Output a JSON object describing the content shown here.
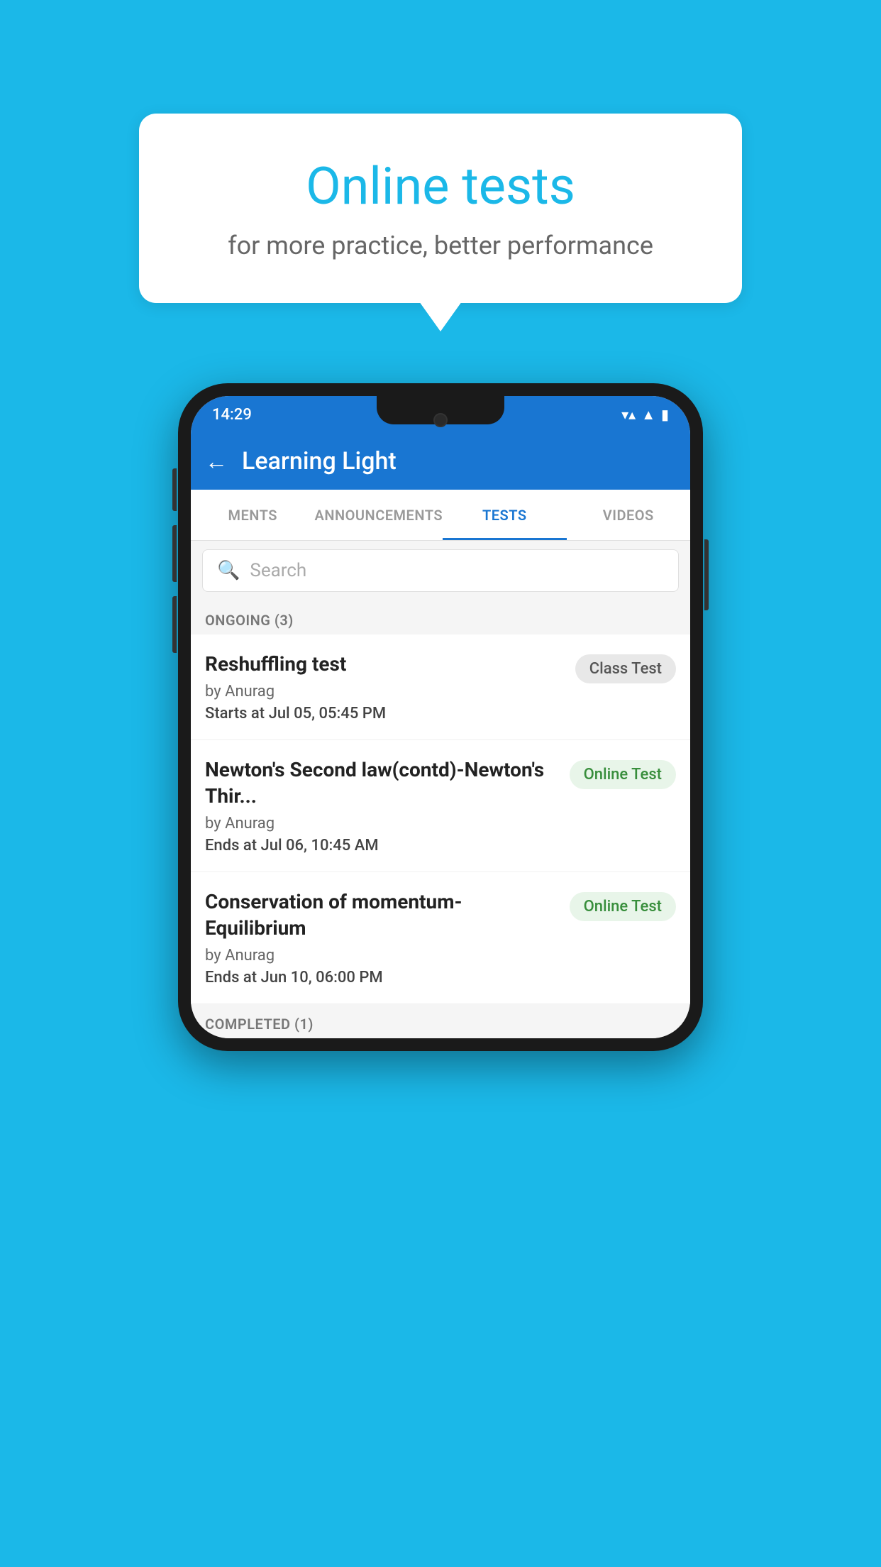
{
  "background_color": "#1BB8E8",
  "bubble": {
    "title": "Online tests",
    "subtitle": "for more practice, better performance"
  },
  "phone": {
    "status_bar": {
      "time": "14:29",
      "wifi": "▼",
      "signal": "▲",
      "battery": "▮"
    },
    "app_bar": {
      "back_label": "←",
      "title": "Learning Light"
    },
    "tabs": [
      {
        "label": "MENTS",
        "active": false
      },
      {
        "label": "ANNOUNCEMENTS",
        "active": false
      },
      {
        "label": "TESTS",
        "active": true
      },
      {
        "label": "VIDEOS",
        "active": false
      }
    ],
    "search": {
      "placeholder": "Search"
    },
    "ongoing_section": {
      "label": "ONGOING (3)"
    },
    "tests": [
      {
        "name": "Reshuffling test",
        "author": "by Anurag",
        "time_label": "Starts at",
        "time_value": "Jul 05, 05:45 PM",
        "badge": "Class Test",
        "badge_type": "class"
      },
      {
        "name": "Newton's Second law(contd)-Newton's Thir...",
        "author": "by Anurag",
        "time_label": "Ends at",
        "time_value": "Jul 06, 10:45 AM",
        "badge": "Online Test",
        "badge_type": "online"
      },
      {
        "name": "Conservation of momentum-Equilibrium",
        "author": "by Anurag",
        "time_label": "Ends at",
        "time_value": "Jun 10, 06:00 PM",
        "badge": "Online Test",
        "badge_type": "online"
      }
    ],
    "completed_section": {
      "label": "COMPLETED (1)"
    }
  }
}
